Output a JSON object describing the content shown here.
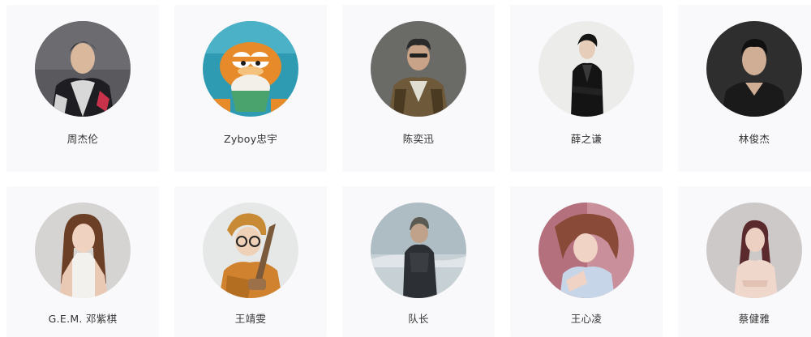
{
  "artists": [
    {
      "name": "周杰伦",
      "avatar_bg": "#5a5a5e"
    },
    {
      "name": "Zyboy忠宇",
      "avatar_bg": "#2f9bb3"
    },
    {
      "name": "陈奕迅",
      "avatar_bg": "#6a6a66"
    },
    {
      "name": "薛之谦",
      "avatar_bg": "#ececea"
    },
    {
      "name": "林俊杰",
      "avatar_bg": "#2e2e2e"
    },
    {
      "name": "G.E.M. 邓紫棋",
      "avatar_bg": "#d6d4d2"
    },
    {
      "name": "王靖雯",
      "avatar_bg": "#e6e8e8"
    },
    {
      "name": "队长",
      "avatar_bg": "#aebcc4"
    },
    {
      "name": "王心凌",
      "avatar_bg": "#c98f9b"
    },
    {
      "name": "蔡健雅",
      "avatar_bg": "#cdc9c8"
    }
  ]
}
